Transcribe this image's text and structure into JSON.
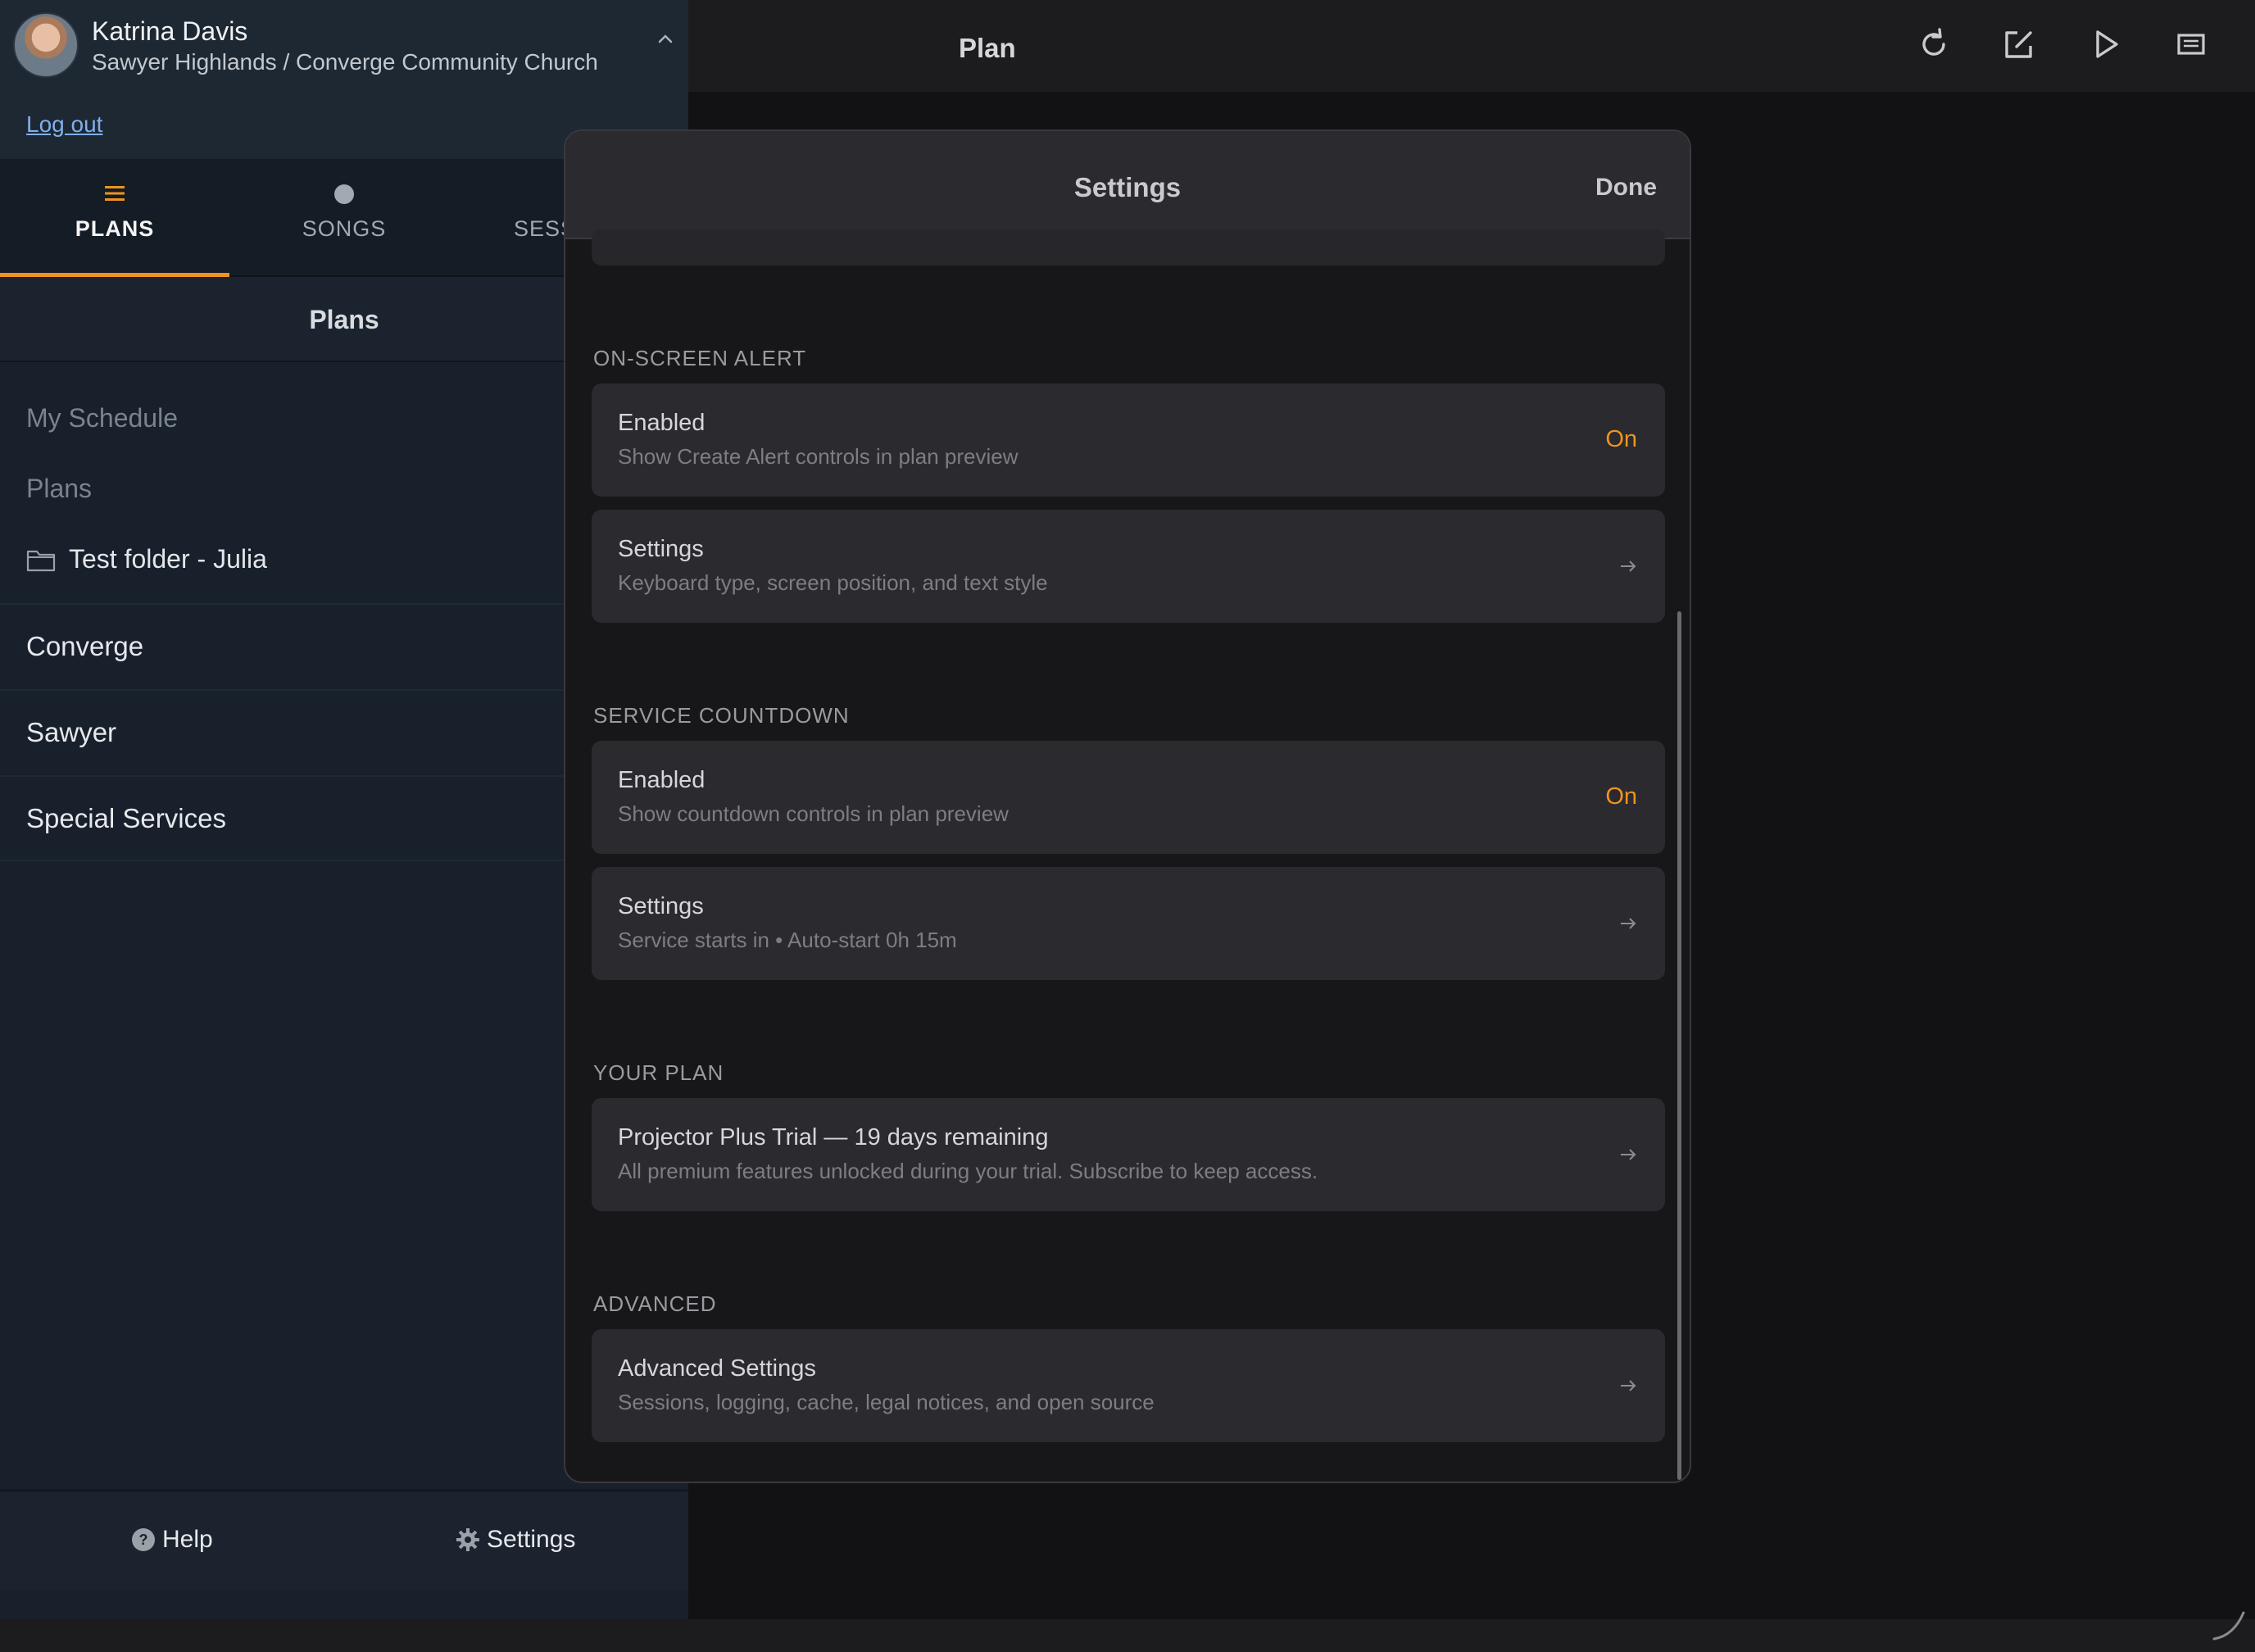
{
  "profile": {
    "name": "Katrina Davis",
    "org": "Sawyer Highlands / Converge Community Church",
    "logout": "Log out"
  },
  "tabs": [
    {
      "label": "PLANS",
      "icon": "hamburger-icon",
      "active": true
    },
    {
      "label": "SONGS",
      "icon": "dot-icon",
      "active": false
    },
    {
      "label": "SESSIONS",
      "icon": "dot-icon",
      "active": false
    }
  ],
  "plans_header": "Plans",
  "nav": {
    "my_schedule": "My Schedule",
    "plans": "Plans",
    "folder": "Test folder - Julia",
    "rows": [
      "Converge",
      "Sawyer",
      "Special Services"
    ]
  },
  "footer": {
    "help": "Help",
    "settings": "Settings"
  },
  "main": {
    "title": "Plan",
    "icons": [
      "refresh-icon",
      "edit-icon",
      "play-icon",
      "present-icon"
    ]
  },
  "modal": {
    "title": "Settings",
    "done": "Done",
    "sections": {
      "alert": {
        "label": "ON-SCREEN ALERT",
        "enabled_title": "Enabled",
        "enabled_sub": "Show Create Alert controls in plan preview",
        "enabled_value": "On",
        "settings_title": "Settings",
        "settings_sub": "Keyboard type, screen position, and text style"
      },
      "countdown": {
        "label": "SERVICE COUNTDOWN",
        "enabled_title": "Enabled",
        "enabled_sub": "Show countdown controls in plan preview",
        "enabled_value": "On",
        "settings_title": "Settings",
        "settings_sub": "Service starts in • Auto-start 0h 15m"
      },
      "plan": {
        "label": "YOUR PLAN",
        "title": "Projector Plus Trial — 19 days remaining",
        "sub": "All premium features unlocked during your trial. Subscribe to keep access."
      },
      "advanced": {
        "label": "ADVANCED",
        "title": "Advanced Settings",
        "sub": "Sessions, logging, cache, legal notices, and open source"
      }
    }
  },
  "colors": {
    "accent": "#f0931e",
    "link": "#7fb0ea",
    "sidebar_bg": "#17202b",
    "modal_bg": "#17171a",
    "card_bg": "#2a2a2f"
  }
}
